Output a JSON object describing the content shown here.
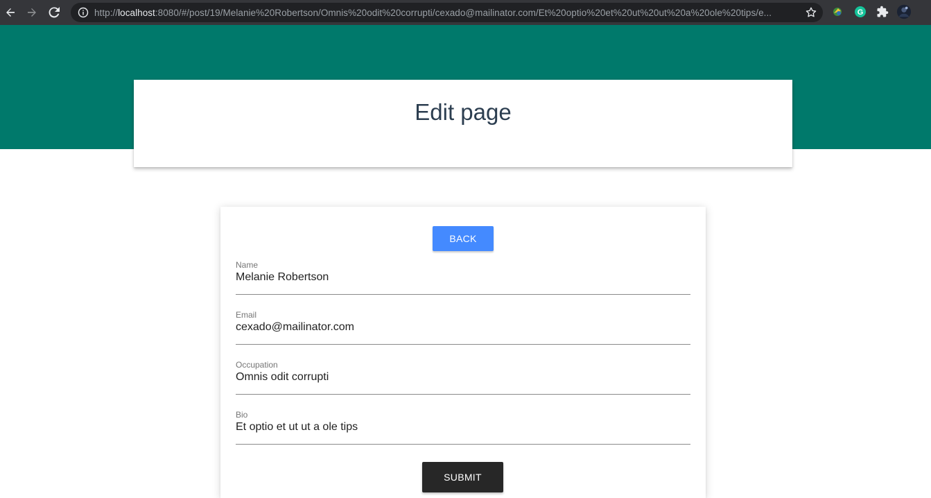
{
  "browser": {
    "url_prefix": "http://",
    "url_host": "localhost",
    "url_rest": ":8080/#/post/19/Melanie%20Robertson/Omnis%20odit%20corrupti/cexado@mailinator.com/Et%20optio%20et%20ut%20ut%20a%20ole%20tips/e...",
    "icons": [
      "back-arrow-icon",
      "forward-arrow-icon",
      "reload-icon",
      "info-icon",
      "bookmark-star-icon",
      "extension-icon",
      "grammarly-icon",
      "extensions-puzzle-icon",
      "profile-avatar-icon"
    ]
  },
  "colors": {
    "hero": "#00796b",
    "back_button": "#448aff",
    "submit_button": "#272727",
    "title_text": "#2c3e50"
  },
  "header": {
    "title": "Edit page"
  },
  "form": {
    "back_label": "BACK",
    "fields": [
      {
        "label": "Name",
        "value": "Melanie Robertson"
      },
      {
        "label": "Email",
        "value": "cexado@mailinator.com"
      },
      {
        "label": "Occupation",
        "value": "Omnis odit corrupti"
      },
      {
        "label": "Bio",
        "value": "Et optio et ut ut a ole tips"
      }
    ],
    "submit_label": "SUBMIT"
  }
}
